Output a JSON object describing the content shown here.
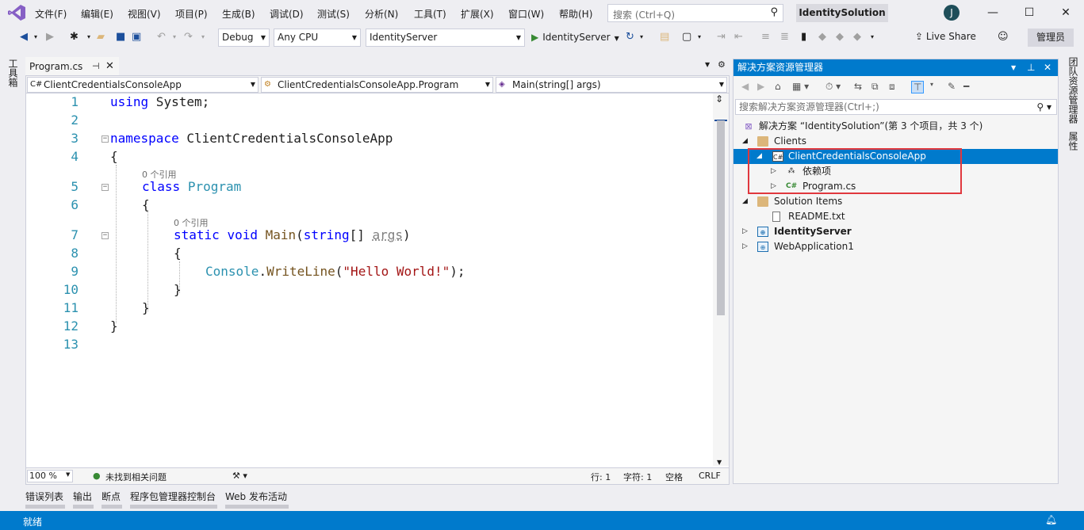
{
  "menu": [
    "文件(F)",
    "编辑(E)",
    "视图(V)",
    "项目(P)",
    "生成(B)",
    "调试(D)",
    "测试(S)",
    "分析(N)",
    "工具(T)",
    "扩展(X)",
    "窗口(W)",
    "帮助(H)"
  ],
  "search": {
    "placeholder": "搜索 (Ctrl+Q)"
  },
  "solution_name": "IdentitySolution",
  "user_initial": "J",
  "toolbar": {
    "config": "Debug",
    "platform": "Any CPU",
    "startup_project": "IdentityServer",
    "run_label": "IdentityServer",
    "live_share": "Live Share",
    "admin": "管理员"
  },
  "left_strip": "工具箱",
  "editor": {
    "tab_label": "Program.cs",
    "nav_project": "ClientCredentialsConsoleApp",
    "nav_class": "ClientCredentialsConsoleApp.Program",
    "nav_member": "Main(string[] args)",
    "line_numbers": [
      "1",
      "2",
      "3",
      "4",
      "5",
      "6",
      "7",
      "8",
      "9",
      "10",
      "11",
      "12",
      "13"
    ],
    "refs": [
      "0 个引用",
      "0 个引用"
    ],
    "code": {
      "l1_kw": "using",
      "l1_rest": " System;",
      "l3_kw": "namespace",
      "l3_rest": " ClientCredentialsConsoleApp",
      "brace_open": "{",
      "brace_close": "}",
      "l5_kw": "class",
      "l5_type": "Program",
      "l7_kw1": "static",
      "l7_kw2": "void",
      "l7_method": "Main",
      "l7_paren": "(",
      "l7_kw3": "string",
      "l7_arr": "[] ",
      "l7_param": "args",
      "l7_close": ")",
      "l9_type": "Console",
      "l9_dot": ".",
      "l9_method": "WriteLine",
      "l9_open": "(",
      "l9_str": "\"Hello World!\"",
      "l9_close": ");"
    },
    "status": {
      "zoom": "100 %",
      "issues": "未找到相关问题",
      "line": "行: 1",
      "col": "字符: 1",
      "spaces": "空格",
      "eol": "CRLF"
    }
  },
  "solution_explorer": {
    "title": "解决方案资源管理器",
    "search_placeholder": "搜索解决方案资源管理器(Ctrl+;)",
    "items": [
      {
        "label": "解决方案 “IdentitySolution”(第 3 个项目，共 3 个)"
      },
      {
        "label": "Clients"
      },
      {
        "label": "ClientCredentialsConsoleApp"
      },
      {
        "label": "依赖项"
      },
      {
        "label": "Program.cs"
      },
      {
        "label": "Solution Items"
      },
      {
        "label": "README.txt"
      },
      {
        "label": "IdentityServer"
      },
      {
        "label": "WebApplication1"
      }
    ]
  },
  "right_strip": [
    "团队资源管理器",
    "属性"
  ],
  "bottom_tabs": [
    "错误列表",
    "输出",
    "断点",
    "程序包管理器控制台",
    "Web 发布活动"
  ],
  "statusbar": {
    "ready": "就绪"
  },
  "colors": {
    "accent": "#007acc",
    "keyword": "#0000ff",
    "type": "#2b91af",
    "string": "#a31515",
    "highlight_box": "#e0383e"
  }
}
